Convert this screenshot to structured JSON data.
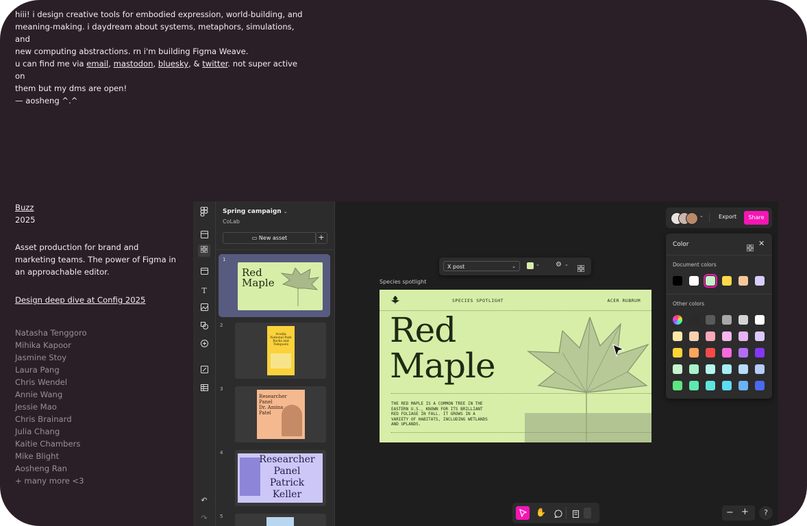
{
  "intro": {
    "para1": [
      "hiii! i design creative tools for embodied expression, world-building, and",
      "meaning-making. i daydream about systems, metaphors, simulations, and",
      "new computing abstractions. rn i'm building Figma Weave."
    ],
    "para2_prefix": "u can find me via ",
    "links": {
      "email": "email",
      "mastodon": "mastodon",
      "bluesky": "bluesky",
      "twitter": "twitter"
    },
    "sep_comma": ", ",
    "sep_and": ", & ",
    "para2_suffix": ". not super active on",
    "para2_line2": "them but my dms are open!",
    "signature": "— aosheng  ^.^"
  },
  "project": {
    "title": "Buzz",
    "year": "2025",
    "description": [
      "Asset production for brand and",
      "marketing teams. The power of Figma in",
      "an approachable editor."
    ],
    "link": "Design deep dive at Config 2025",
    "credits": [
      "Natasha Tenggoro",
      "Mihika Kapoor",
      "Jasmine Stoy",
      "Laura Pang",
      "Chris Wendel",
      "Annie Wang",
      "Jessie Mao",
      "Chris Brainard",
      "Julia Chang",
      "Kaitie Chambers",
      "Mike Blight",
      "Aosheng Ran",
      "+ many more <3"
    ]
  },
  "app": {
    "file_title": "Spring campaign",
    "team": "CoLab",
    "new_asset_label": "New asset",
    "thumbnails": [
      {
        "num": "1",
        "line1": "Red",
        "line2": "Maple"
      },
      {
        "num": "2",
        "text1": "Acadia",
        "text2": "National Park",
        "text3": "Rocks and",
        "text4": "Tidepools"
      },
      {
        "num": "3",
        "line1": "Researcher",
        "line2": "Panel",
        "line3": "Dr. Amina",
        "line4": "Patel"
      },
      {
        "num": "4",
        "line1": "Researcher",
        "line2": "Panel",
        "line3": "Patrick",
        "line4": "Keller"
      },
      {
        "num": "5"
      }
    ],
    "format_select": "X post",
    "frame_label": "Species spotlight",
    "spotlight": {
      "tag_left": "SPECIES SPOTLIGHT",
      "tag_right": "ACER RUBRUM",
      "title1": "Red",
      "title2": "Maple",
      "body": [
        "THE RED MAPLE IS A COMMON TREE IN THE",
        "EASTERN U.S., KNOWN FOR ITS BRILLIANT",
        "RED FOLIAGE IN FALL. IT GROWS IN A",
        "VARIETY OF HABITATS, INCLUDING WETLANDS",
        "AND UPLANDS."
      ]
    },
    "export_label": "Export",
    "share_label": "Share",
    "color_panel": {
      "title": "Color",
      "document_colors_label": "Document colors",
      "document_colors": [
        "#000000",
        "#ffffff",
        "#c6f0c8",
        "#ffd84a",
        "#f5c89a",
        "#d9cdfc"
      ],
      "other_colors_label": "Other colors",
      "other_colors": [
        [
          "gradient",
          "#2a2a2a",
          "#5a5a5a",
          "#a8a8a8",
          "#d4d4d4",
          "#ffffff"
        ],
        [
          "#fde8a8",
          "#fbd0b0",
          "#f9a8b8",
          "#f8b6ec",
          "#e8b4f4",
          "#dccafc"
        ],
        [
          "#fcd33a",
          "#fca45a",
          "#f44a4a",
          "#f66ae0",
          "#b46ef6",
          "#8438f6"
        ],
        [
          "#c7f3cf",
          "#a8f1c8",
          "#b6f6ec",
          "#a6ecf6",
          "#b8dcfb",
          "#b6ccfb"
        ],
        [
          "#5ee67e",
          "#5ee8b0",
          "#5ee6de",
          "#5edcf6",
          "#6ab4f6",
          "#4a6af0"
        ]
      ]
    },
    "colors": {
      "accent": "#f516b4",
      "card_bg": "#d7eea8",
      "text_dark": "#1e2a14"
    }
  }
}
